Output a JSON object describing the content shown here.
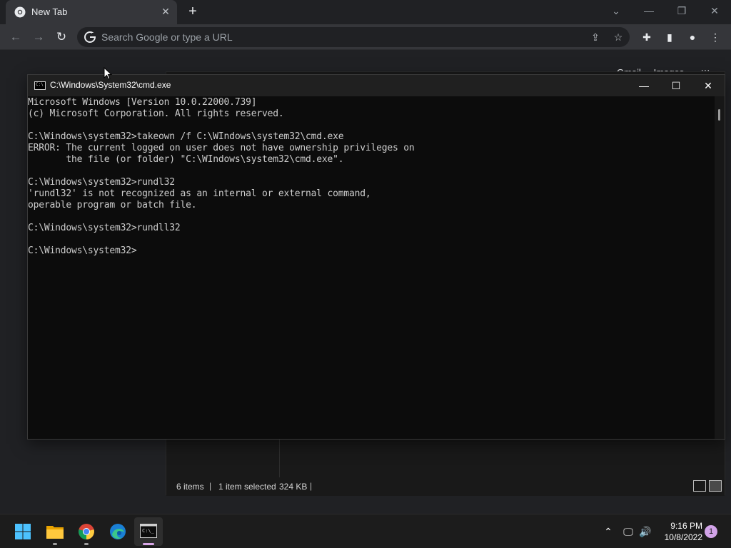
{
  "browser": {
    "tab_title": "New Tab",
    "omnibox_placeholder": "Search Google or type a URL",
    "ntp_links": [
      "Gmail",
      "Images"
    ]
  },
  "explorer": {
    "status": {
      "items": "6 items",
      "selected": "1 item selected",
      "size": "324 KB"
    }
  },
  "cmd": {
    "title": "C:\\Windows\\System32\\cmd.exe",
    "lines": [
      "Microsoft Windows [Version 10.0.22000.739]",
      "(c) Microsoft Corporation. All rights reserved.",
      "",
      "C:\\Windows\\system32>takeown /f C:\\WIndows\\system32\\cmd.exe",
      "ERROR: The current logged on user does not have ownership privileges on",
      "       the file (or folder) \"C:\\WIndows\\system32\\cmd.exe\".",
      "",
      "C:\\Windows\\system32>rundl32",
      "'rundl32' is not recognized as an internal or external command,",
      "operable program or batch file.",
      "",
      "C:\\Windows\\system32>rundll32",
      "",
      "C:\\Windows\\system32>"
    ]
  },
  "taskbar": {
    "apps": [
      "start-icon",
      "file-explorer-icon",
      "chrome-icon",
      "edge-icon",
      "terminal-icon"
    ],
    "time": "9:16 PM",
    "date": "10/8/2022",
    "notifications": "1"
  },
  "colors": {
    "console_bg": "#0c0c0c",
    "console_text": "#cccccc",
    "accent": "#d2a3e8"
  }
}
